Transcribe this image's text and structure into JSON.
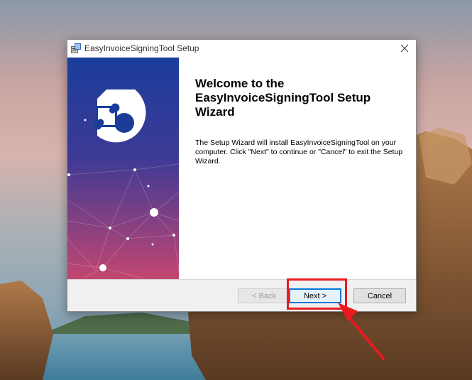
{
  "window": {
    "title": "EasyInvoiceSigningTool Setup"
  },
  "content": {
    "heading": "Welcome to the EasyInvoiceSigningTool Setup Wizard",
    "body": "The Setup Wizard will install EasyInvoiceSigningTool on your computer.  Click \"Next\" to continue or \"Cancel\" to exit the Setup Wizard."
  },
  "buttons": {
    "back_label": "< Back",
    "next_label": "Next >",
    "cancel_label": "Cancel"
  },
  "colors": {
    "banner_top": "#1b3d9a",
    "banner_bottom": "#c24670",
    "highlight": "#e8191f",
    "focus_border": "#0078d7"
  },
  "icons": {
    "app": "installer-icon",
    "close": "close-icon",
    "banner_logo": "puzzle-logo-icon",
    "annotation_arrow": "arrow-icon"
  }
}
